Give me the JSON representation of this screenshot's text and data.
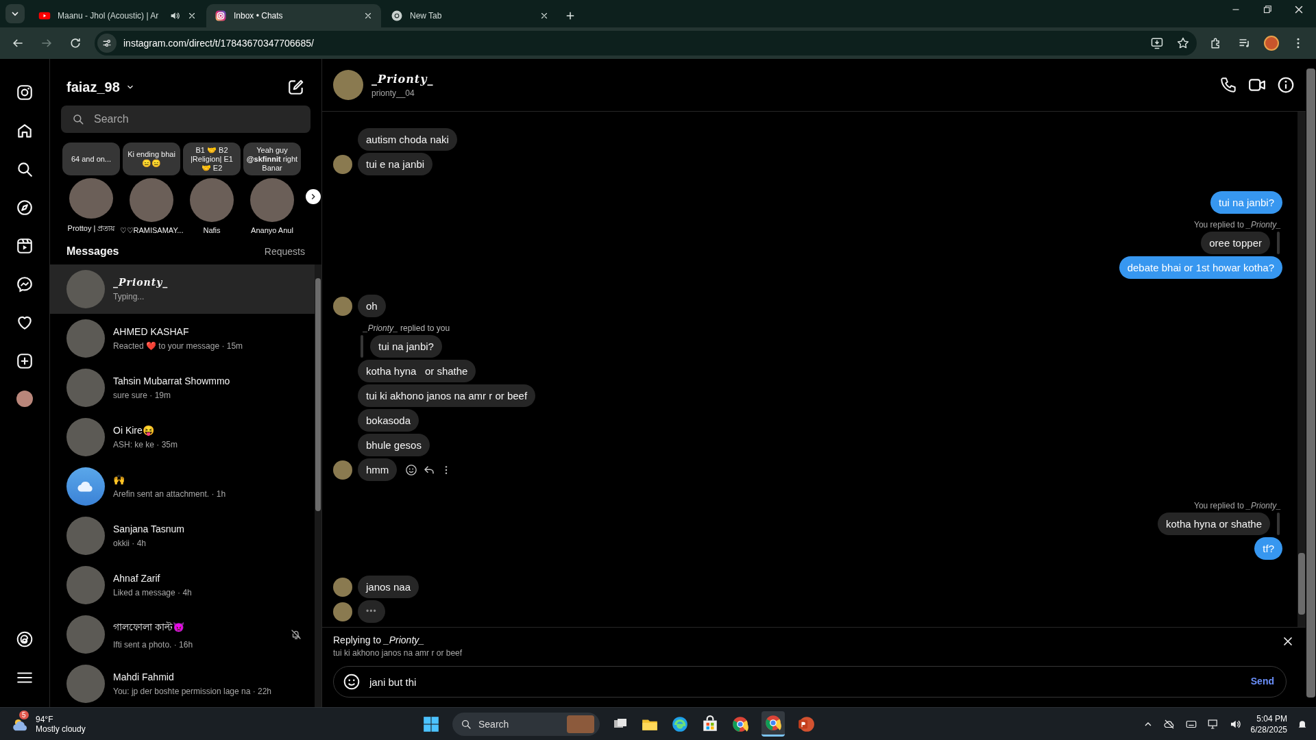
{
  "browser": {
    "tabs": [
      {
        "title": "Maanu - Jhol (Acoustic) | Ar",
        "audio": true,
        "selected": false
      },
      {
        "title": "Inbox • Chats",
        "audio": false,
        "selected": true
      },
      {
        "title": "New Tab",
        "audio": false,
        "selected": false
      }
    ],
    "url": "instagram.com/direct/t/17843670347706685/"
  },
  "sidebar": {
    "username": "faiaz_98",
    "search": {
      "placeholder": "Search"
    },
    "notes": [
      {
        "note": "64 and on...",
        "name": "Prottoy | প্রত্যয়"
      },
      {
        "note": "Ki ending bhai 😑😑",
        "name": "♡♡RAMISAMAY..."
      },
      {
        "note": "B1 🤝 B2 |Religion| E1 🤝 E2",
        "name": "Nafis"
      },
      {
        "note": "Yeah guy **@skfinnit** right Banar",
        "name": "Ananyo Anul"
      }
    ],
    "messages_heading": "Messages",
    "requests_link": "Requests",
    "conversations": [
      {
        "name": "_Prionty_",
        "fancy": true,
        "preview": "Typing...",
        "kind": "photo",
        "muted": false,
        "selected": true
      },
      {
        "name": "AHMED KASHAF",
        "fancy": false,
        "preview": "Reacted ❤️ to your message · 15m",
        "kind": "photo",
        "muted": false,
        "selected": false
      },
      {
        "name": "Tahsin Mubarrat Showmmo",
        "fancy": false,
        "preview": "sure sure · 19m",
        "kind": "photo",
        "muted": false,
        "selected": false
      },
      {
        "name": "Oi Kire😝",
        "fancy": false,
        "preview": "ASH: ke ke · 35m",
        "kind": "photo",
        "muted": false,
        "selected": false
      },
      {
        "name": "🙌",
        "fancy": false,
        "preview": "Arefin sent an attachment. · 1h",
        "kind": "default",
        "muted": false,
        "selected": false
      },
      {
        "name": "Sanjana Tasnum",
        "fancy": false,
        "preview": "okkii · 4h",
        "kind": "photo",
        "muted": false,
        "selected": false
      },
      {
        "name": "Ahnaf Zarif",
        "fancy": false,
        "preview": "Liked a message · 4h",
        "kind": "photo",
        "muted": false,
        "selected": false
      },
      {
        "name": "গালফোলা কাল্ট👿",
        "fancy": false,
        "preview": "Ifti sent a photo. · 16h",
        "kind": "photo",
        "muted": true,
        "selected": false
      },
      {
        "name": "Mahdi Fahmid",
        "fancy": false,
        "preview": "You: jp der boshte permission lage na · 22h",
        "kind": "photo",
        "muted": false,
        "selected": false
      }
    ]
  },
  "chat": {
    "header": {
      "name": "_Prionty_",
      "username": "prionty__04"
    },
    "messages": [
      {
        "kind": "text",
        "sent": false,
        "text": "autism choda naki",
        "avatar": false,
        "actions": false
      },
      {
        "kind": "text",
        "sent": false,
        "text": "tui e na janbi",
        "avatar": true,
        "actions": false
      },
      {
        "kind": "text",
        "sent": true,
        "text": "tui na janbi?",
        "avatar": false,
        "actions": false
      },
      {
        "kind": "reply_label",
        "sent": true,
        "text": "You replied to *_Prionty_*",
        "avatar": false,
        "actions": false
      },
      {
        "kind": "quote",
        "sent": true,
        "text": "oree topper",
        "avatar": false,
        "actions": false
      },
      {
        "kind": "text",
        "sent": true,
        "text": "debate bhai or 1st howar kotha?",
        "avatar": false,
        "actions": false
      },
      {
        "kind": "text",
        "sent": false,
        "text": "oh",
        "avatar": true,
        "actions": false
      },
      {
        "kind": "reply_label",
        "sent": false,
        "text": "*_Prionty_* replied to you",
        "avatar": false,
        "actions": false
      },
      {
        "kind": "quote",
        "sent": false,
        "text": "tui na janbi?",
        "avatar": false,
        "actions": false
      },
      {
        "kind": "text",
        "sent": false,
        "text": "kotha hyna   or shathe",
        "avatar": false,
        "actions": false
      },
      {
        "kind": "text",
        "sent": false,
        "text": "tui ki akhono janos na amr r or beef",
        "avatar": false,
        "actions": false
      },
      {
        "kind": "text",
        "sent": false,
        "text": "bokasoda",
        "avatar": false,
        "actions": false
      },
      {
        "kind": "text",
        "sent": false,
        "text": "bhule gesos",
        "avatar": false,
        "actions": false
      },
      {
        "kind": "text",
        "sent": false,
        "text": "hmm",
        "avatar": true,
        "actions": true
      },
      {
        "kind": "reply_label",
        "sent": true,
        "text": "You replied to *_Prionty_*",
        "avatar": false,
        "actions": false
      },
      {
        "kind": "quote",
        "sent": true,
        "text": "kotha hyna or shathe",
        "avatar": false,
        "actions": false
      },
      {
        "kind": "text",
        "sent": true,
        "text": "tf?",
        "avatar": false,
        "actions": false
      },
      {
        "kind": "text",
        "sent": false,
        "text": "janos naa",
        "avatar": true,
        "actions": false
      },
      {
        "kind": "typing",
        "sent": false,
        "text": "•••",
        "avatar": true,
        "actions": false
      }
    ],
    "reply_bar": {
      "label": "Replying to *_Prionty_*",
      "quoted": "tui ki akhono janos na amr r or beef"
    },
    "composer": {
      "value": "jani but thi",
      "send": "Send"
    }
  },
  "taskbar": {
    "weather": {
      "badge": "5",
      "temp": "94°F",
      "condition": "Mostly cloudy"
    },
    "search": "Search",
    "clock": {
      "time": "5:04 PM",
      "date": "6/28/2025"
    }
  }
}
